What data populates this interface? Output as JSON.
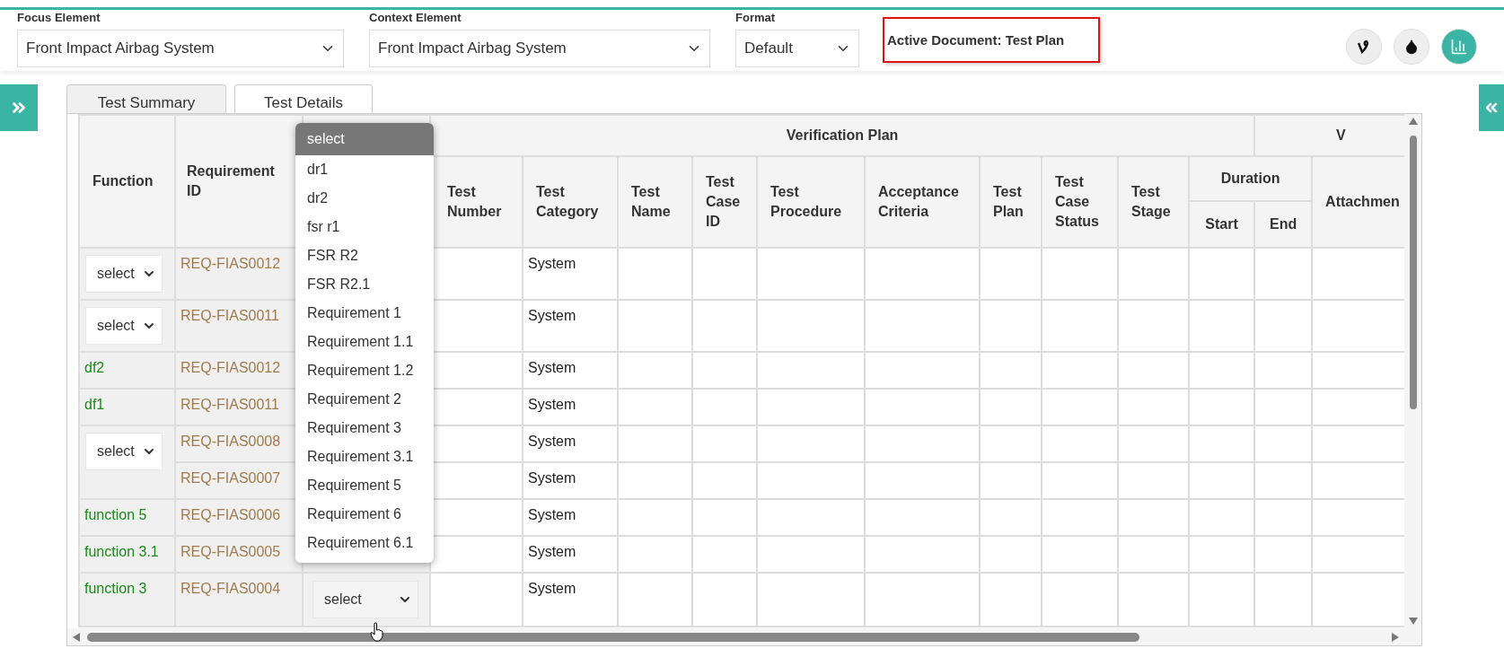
{
  "filters": [
    {
      "label": "Focus Element",
      "value": "Front Impact Airbag System"
    },
    {
      "label": "Context Element",
      "value": "Front Impact Airbag System"
    },
    {
      "label": "Format",
      "value": "Default"
    }
  ],
  "active_document": "Active Document: Test Plan",
  "tabs": [
    {
      "label": "Test Summary",
      "selected": false
    },
    {
      "label": "Test Details",
      "selected": true
    }
  ],
  "table": {
    "group_headers": [
      "Verification Plan",
      "V"
    ],
    "fixed_columns": [
      "Function",
      "Requirement ID"
    ],
    "plan_columns": [
      "Test Number",
      "Test Category",
      "Test Name",
      "Test Case ID",
      "Test Procedure",
      "Acceptance Criteria",
      "Test Plan",
      "Test Case Status",
      "Test Stage"
    ],
    "duration": {
      "label": "Duration",
      "start": "Start",
      "end": "End"
    },
    "last_column": "Attachmen",
    "rows": [
      {
        "function": {
          "kind": "select",
          "text": "select"
        },
        "requirement_id": "REQ-FIAS0012",
        "test_category": "System"
      },
      {
        "function": {
          "kind": "select",
          "text": "select"
        },
        "requirement_id": "REQ-FIAS0011",
        "test_category": "System"
      },
      {
        "function": {
          "kind": "text",
          "text": "df2"
        },
        "requirement_id": "REQ-FIAS0012",
        "test_category": "System"
      },
      {
        "function": {
          "kind": "text",
          "text": "df1"
        },
        "requirement_id": "REQ-FIAS0011",
        "test_category": "System"
      },
      {
        "function": {
          "kind": "select",
          "text": "select"
        },
        "requirement_id": "REQ-FIAS0008",
        "test_category": "System"
      },
      {
        "requirement_id": "REQ-FIAS0007",
        "test_category": "System"
      },
      {
        "function": {
          "kind": "text",
          "text": "function 5"
        },
        "requirement_id": "REQ-FIAS0006",
        "test_category": "System"
      },
      {
        "function": {
          "kind": "text",
          "text": "function 3.1"
        },
        "requirement_id": "REQ-FIAS0005",
        "test_category": "System"
      },
      {
        "function": {
          "kind": "text",
          "text": "function 3"
        },
        "requirement_id": "REQ-FIAS0004",
        "column_3": "select",
        "test_category": "System"
      }
    ]
  },
  "open_dropdown": {
    "options": [
      {
        "label": "select",
        "selected": true
      },
      {
        "label": "dr1",
        "selected": false
      },
      {
        "label": "dr2",
        "selected": false
      },
      {
        "label": "fsr r1",
        "selected": false
      },
      {
        "label": "FSR R2",
        "selected": false
      },
      {
        "label": "FSR R2.1",
        "selected": false
      },
      {
        "label": "Requirement 1",
        "selected": false
      },
      {
        "label": "Requirement 1.1",
        "selected": false
      },
      {
        "label": "Requirement 1.2",
        "selected": false
      },
      {
        "label": "Requirement 2",
        "selected": false
      },
      {
        "label": "Requirement 3",
        "selected": false
      },
      {
        "label": "Requirement 3.1",
        "selected": false
      },
      {
        "label": "Requirement 5",
        "selected": false
      },
      {
        "label": "Requirement 6",
        "selected": false
      },
      {
        "label": "Requirement 6.1",
        "selected": false
      }
    ]
  }
}
